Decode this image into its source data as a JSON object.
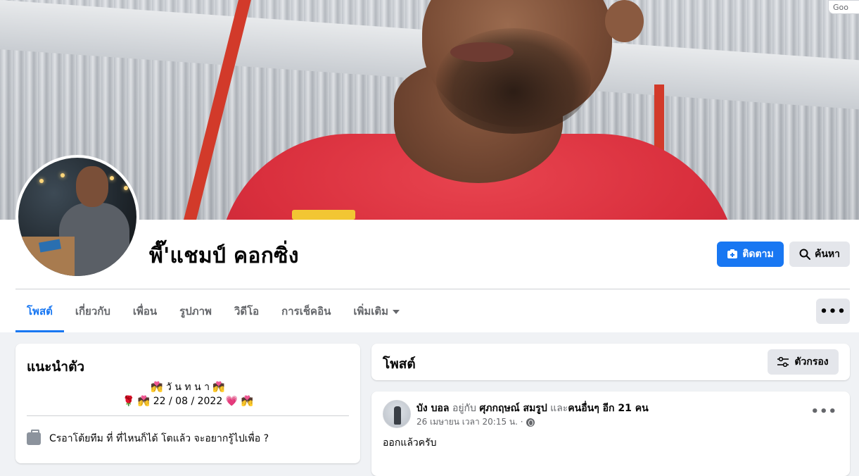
{
  "profile": {
    "name": "พี๊'แชมป์ คอกซิ่ง",
    "follow_label": "ติดตาม",
    "search_label": "ค้นหา"
  },
  "corner_label": "Goo",
  "tabs": [
    {
      "label": "โพสต์",
      "active": true
    },
    {
      "label": "เกี่ยวกับ"
    },
    {
      "label": "เพื่อน"
    },
    {
      "label": "รูปภาพ"
    },
    {
      "label": "วิดีโอ"
    },
    {
      "label": "การเช็คอิน"
    },
    {
      "label": "เพิ่มเติม"
    }
  ],
  "more_label": "•••",
  "intro": {
    "title": "แนะนำตัว",
    "bio_line1": "💏 วั น ท น า 💏",
    "bio_line2": "🌹 💏 22 / 08 / 2022 💗 💏",
    "work_text": "Cรอาโต้ยทีม ที่ ที่ไหนก็ได้ โตแล้ว จะอยากรู้ไปเพื่อ ?"
  },
  "posts": {
    "title": "โพสต์",
    "filter_label": "ตัวกรอง"
  },
  "post": {
    "author": "บัง บอล",
    "with_text": "อยู่กับ",
    "tagged": "ศุภกฤษณ์ สมรูป",
    "and_text": "และ",
    "others": "คนอื่นๆ อีก 21 คน",
    "time": "26 เมษายน เวลา 20:15 น. ·",
    "text": "ออกแล้วครับ",
    "more": "•••"
  },
  "colors": {
    "accent": "#1877f2",
    "background": "#f0f2f5",
    "secondary_button": "#e4e6eb"
  }
}
